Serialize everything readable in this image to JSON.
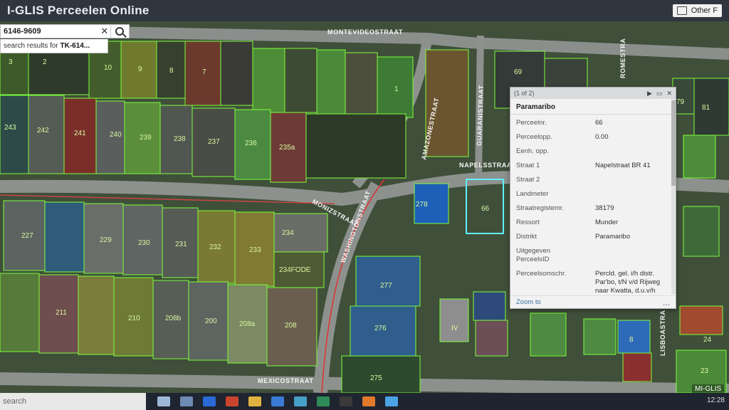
{
  "header": {
    "title": "I-GLIS Perceelen Online",
    "other_label": "Other F"
  },
  "search": {
    "value": "6146-9609",
    "suggestion_prefix": "search results for ",
    "suggestion_bold": "TK-614..."
  },
  "streets": [
    "MONTEVIDEOSTRAAT",
    "AMAZONESTRAAT",
    "GUARANISTRAAT",
    "NAPELSSTRAAT",
    "MONIZSTRAAT",
    "WASHINGTONSTRAAT",
    "MEXICOSTRAAT",
    "ROMESTRA",
    "LISBOASTRA"
  ],
  "parcels": [
    "3",
    "2",
    "10",
    "9",
    "8",
    "7",
    "1",
    "243",
    "242",
    "241",
    "240",
    "239",
    "238",
    "237",
    "236",
    "235a",
    "227",
    "229",
    "230",
    "231",
    "232",
    "233",
    "234",
    "234FODE",
    "211",
    "210",
    "208b",
    "200",
    "208a",
    "208",
    "278",
    "277",
    "276",
    "275",
    "IV",
    "69",
    "81",
    "79",
    "8",
    "23",
    "24",
    "66"
  ],
  "popup": {
    "counter": "(1 of 2)",
    "title": "Paramaribo",
    "attributes": [
      {
        "key": "Perceelnr.",
        "value": "66"
      },
      {
        "key": "Perceelopp.",
        "value": "0.00"
      },
      {
        "key": "Eenh. opp.",
        "value": ""
      },
      {
        "key": "Straat 1",
        "value": "Napelstraat BR 41"
      },
      {
        "key": "Straat 2",
        "value": ""
      },
      {
        "key": "Landmeter",
        "value": ""
      },
      {
        "key": "Straatregistemr.",
        "value": "38179"
      },
      {
        "key": "Ressort",
        "value": "Munder"
      },
      {
        "key": "Distrikt",
        "value": "Paramaribo"
      },
      {
        "key": "Uitgegeven PerceelsID",
        "value": ""
      },
      {
        "key": "Perceelsomschr.",
        "value": "Percld. gel. i/h distr. Par'bo, t/N v/d Rijweg naar Kwatta, d.u.v/h percld. bekend als"
      }
    ],
    "zoom_label": "Zoom to",
    "more_label": "..."
  },
  "watermark": "MI-GLIS",
  "taskbar": {
    "search_placeholder": "search",
    "clock": "12:28"
  }
}
